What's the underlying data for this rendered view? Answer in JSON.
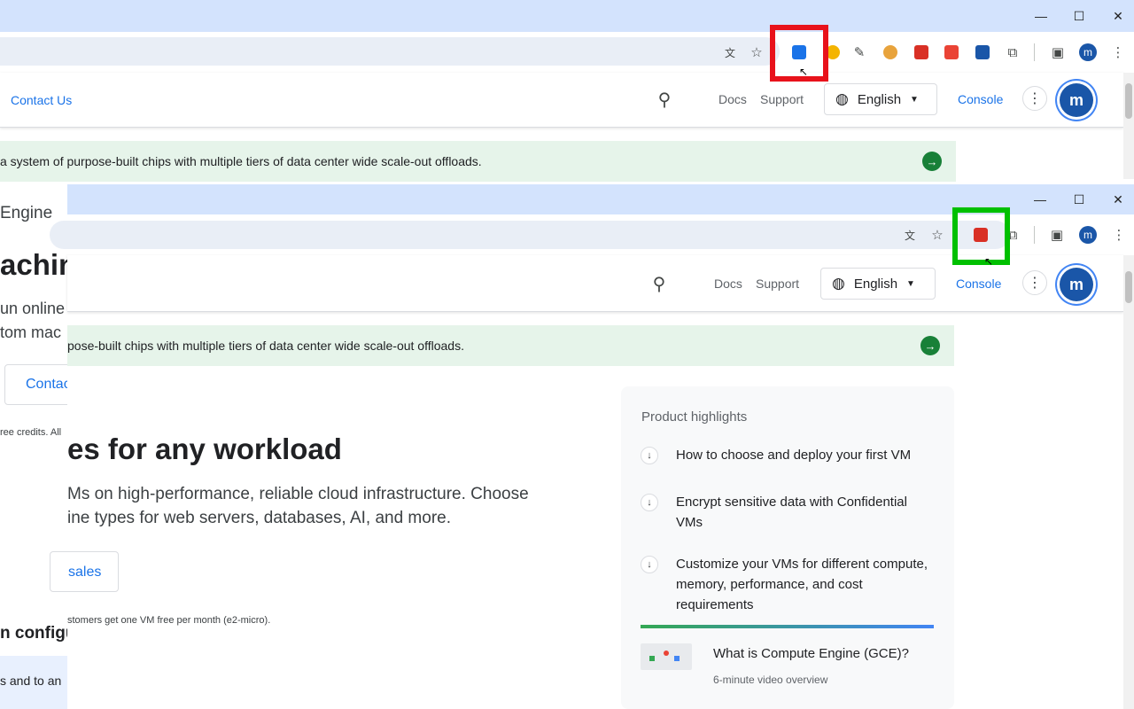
{
  "back_window": {
    "window_controls": {
      "minimize": "—",
      "maximize": "☐",
      "close": "✕"
    },
    "nav": {
      "contact_us": "Contact Us",
      "docs": "Docs",
      "support": "Support",
      "language": "English",
      "console": "Console",
      "avatar_letter": "m"
    },
    "banner_text": "a system of purpose-built chips with multiple tiers of data center wide scale-out offloads.",
    "left_fragments": {
      "engine": "Engine",
      "machine": "achin",
      "run_online": "un online",
      "custom_mac": "tom mac",
      "contact_button": "Contac",
      "credits": "ree credits. All",
      "config": "n configu",
      "and_to": "s and to an"
    },
    "profile_letter": "m"
  },
  "front_window": {
    "window_controls": {
      "minimize": "—",
      "maximize": "☐",
      "close": "✕"
    },
    "nav": {
      "docs": "Docs",
      "support": "Support",
      "language": "English",
      "console": "Console",
      "avatar_letter": "m"
    },
    "banner_text": "pose-built chips with multiple tiers of data center wide scale-out offloads.",
    "hero": {
      "heading": "es for any workload",
      "line1": "Ms on high-performance, reliable cloud infrastructure. Choose",
      "line2": "ine types for web servers, databases, AI, and more.",
      "sales_button": "sales",
      "free_note": "stomers get one VM free per month (e2-micro)."
    },
    "highlights": {
      "title": "Product highlights",
      "items": [
        "How to choose and deploy your first VM",
        "Encrypt sensitive data with Confidential VMs",
        "Customize your VMs for different compute, memory, performance, and cost requirements"
      ],
      "video_title": "What is Compute Engine (GCE)?",
      "video_sub": "6-minute video overview"
    },
    "profile_letter": "m"
  },
  "colors": {
    "red_box": "#e8121b",
    "green_box": "#00c000",
    "titlebar": "#d3e3fd",
    "banner": "#e6f4ea",
    "link_blue": "#1a73e8"
  },
  "icons": [
    "translate-icon",
    "star-icon",
    "extension-icon",
    "puzzle-icon",
    "side-panel-icon",
    "more-vert-icon",
    "search-icon",
    "globe-icon",
    "caret-down-icon",
    "arrow-right-icon",
    "arrow-down-icon"
  ]
}
